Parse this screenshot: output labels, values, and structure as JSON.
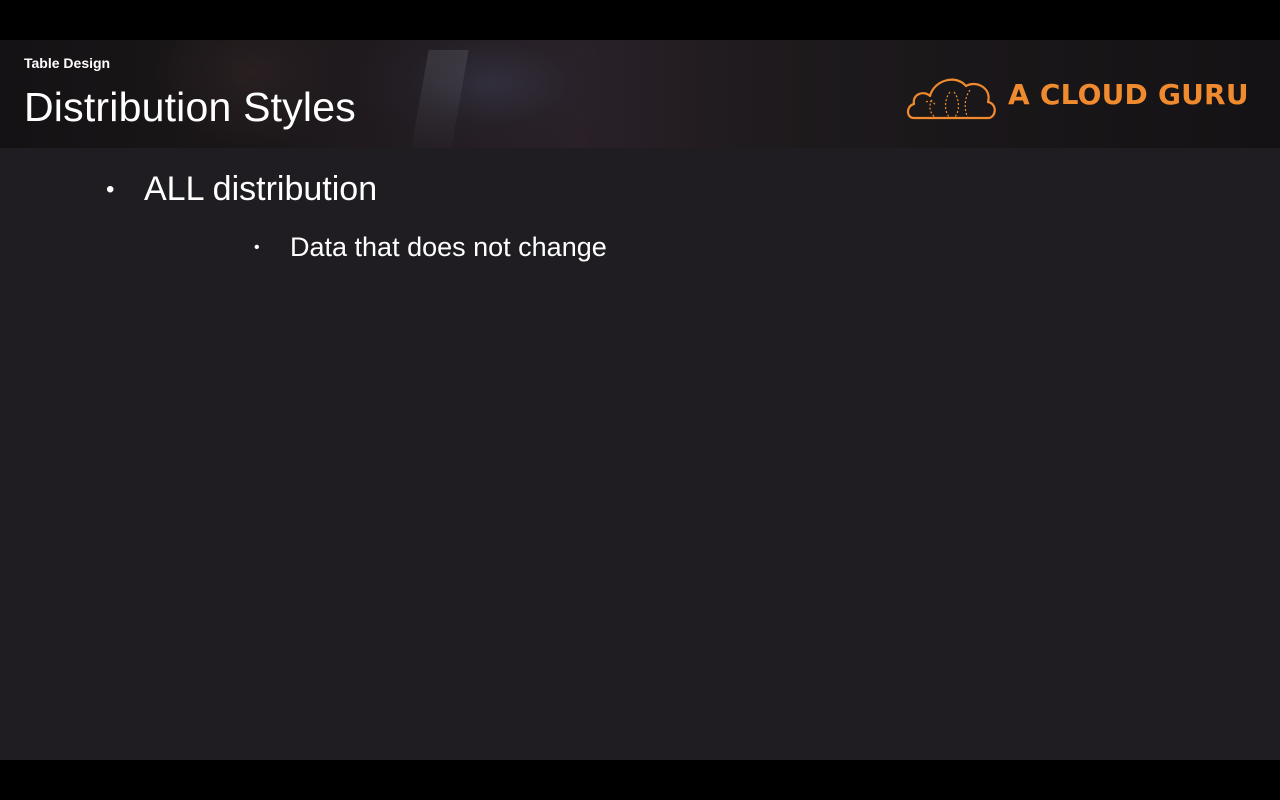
{
  "header": {
    "section_label": "Table Design",
    "title": "Distribution Styles",
    "logo_text": "A CLOUD GURU"
  },
  "content": {
    "bullets": [
      {
        "text": "ALL distribution",
        "sub_bullets": [
          {
            "text": "Data that does not change"
          }
        ]
      }
    ]
  },
  "colors": {
    "slide_background": "#1f1d21",
    "letterbox": "#000000",
    "text": "#ffffff",
    "brand_orange": "#f08a2f"
  },
  "icons": {
    "logo_icon": "cloud-logo-icon",
    "bullet_marker": "bullet-dot-icon"
  }
}
